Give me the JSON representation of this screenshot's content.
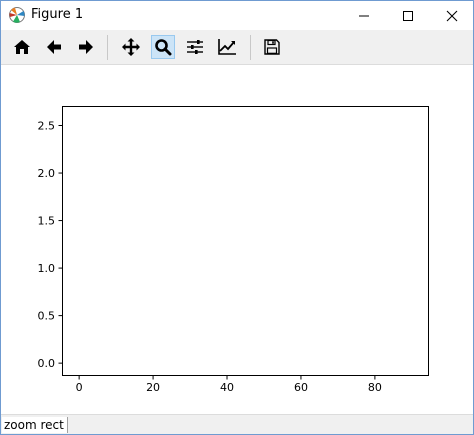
{
  "window": {
    "title": "Figure 1"
  },
  "toolbar": {
    "buttons": [
      {
        "name": "home",
        "icon": "home-icon"
      },
      {
        "name": "back",
        "icon": "arrow-left-icon"
      },
      {
        "name": "forward",
        "icon": "arrow-right-icon"
      },
      {
        "name": "pan",
        "icon": "move-icon"
      },
      {
        "name": "zoom",
        "icon": "magnifier-icon",
        "active": true
      },
      {
        "name": "configure-subplots",
        "icon": "sliders-icon"
      },
      {
        "name": "edit-axes",
        "icon": "line-chart-icon"
      },
      {
        "name": "save",
        "icon": "floppy-disk-icon"
      }
    ]
  },
  "status": {
    "text": "zoom rect"
  },
  "colors": {
    "active_button_bg": "#cce4f7",
    "window_border": "#6f9bd1",
    "toolbar_bg": "#f0f0f0"
  },
  "chart_data": {
    "type": "line",
    "series": [],
    "xlim": [
      -4.5,
      94.5
    ],
    "ylim": [
      -0.13,
      2.7
    ],
    "xticks": [
      0,
      20,
      40,
      60,
      80
    ],
    "xtick_labels": [
      "0",
      "20",
      "40",
      "60",
      "80"
    ],
    "yticks": [
      0.0,
      0.5,
      1.0,
      1.5,
      2.0,
      2.5
    ],
    "ytick_labels": [
      "0.0",
      "0.5",
      "1.0",
      "1.5",
      "2.0",
      "2.5"
    ],
    "grid": false
  }
}
